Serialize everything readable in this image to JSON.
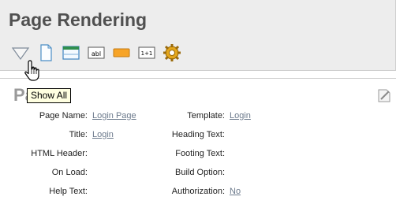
{
  "header": {
    "title": "Page Rendering"
  },
  "toolbar": {
    "buttons": [
      {
        "icon": "filter-triangle-icon",
        "tooltip": "Show All"
      },
      {
        "icon": "page-icon"
      },
      {
        "icon": "region-icon"
      },
      {
        "icon": "text-item-icon",
        "text": "abl"
      },
      {
        "icon": "button-icon"
      },
      {
        "icon": "computation-icon",
        "text": "1+1"
      },
      {
        "icon": "gear-icon"
      }
    ]
  },
  "tooltip": {
    "text": "Show All"
  },
  "section": {
    "title": "Pa"
  },
  "properties": {
    "page_name": {
      "label": "Page Name:",
      "value": "Login Page"
    },
    "title": {
      "label": "Title:",
      "value": "Login"
    },
    "html_header": {
      "label": "HTML Header:",
      "value": ""
    },
    "on_load": {
      "label": "On Load:",
      "value": ""
    },
    "help_text": {
      "label": "Help Text:",
      "value": ""
    },
    "template": {
      "label": "Template:",
      "value": "Login"
    },
    "heading_text": {
      "label": "Heading Text:",
      "value": ""
    },
    "footing_text": {
      "label": "Footing Text:",
      "value": ""
    },
    "build_option": {
      "label": "Build Option:",
      "value": ""
    },
    "authorization": {
      "label": "Authorization:",
      "value": "No"
    }
  },
  "colors": {
    "panel_bg": "#ededed",
    "link": "#6c7a8c",
    "tooltip_bg": "#ffffe1"
  }
}
